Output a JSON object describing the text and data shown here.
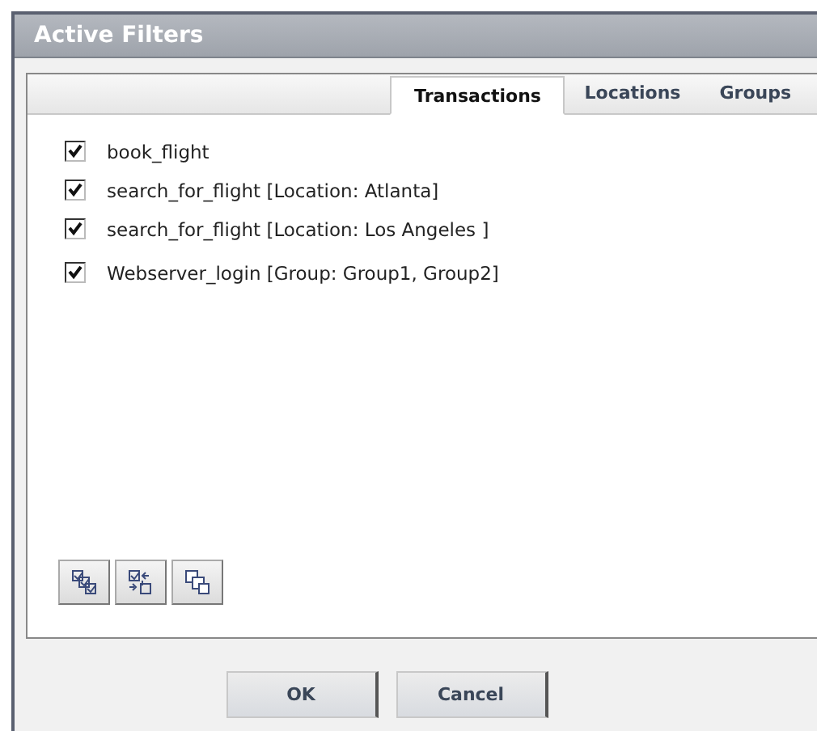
{
  "window": {
    "title": "Active Filters"
  },
  "tabs": [
    {
      "label": "Transactions",
      "selected": true
    },
    {
      "label": "Locations",
      "selected": false
    },
    {
      "label": "Groups",
      "selected": false
    }
  ],
  "filters": [
    {
      "label": "book_flight",
      "checked": true
    },
    {
      "label": "search_for_flight [Location: Atlanta]",
      "checked": true
    },
    {
      "label": "search_for_flight [Location: Los Angeles ]",
      "checked": true
    },
    {
      "label": "Webserver_login [Group: Group1, Group2]",
      "checked": true
    }
  ],
  "tools": [
    {
      "kind": "select-all"
    },
    {
      "kind": "invert"
    },
    {
      "kind": "clear"
    }
  ],
  "buttons": [
    "OK",
    "Cancel"
  ]
}
